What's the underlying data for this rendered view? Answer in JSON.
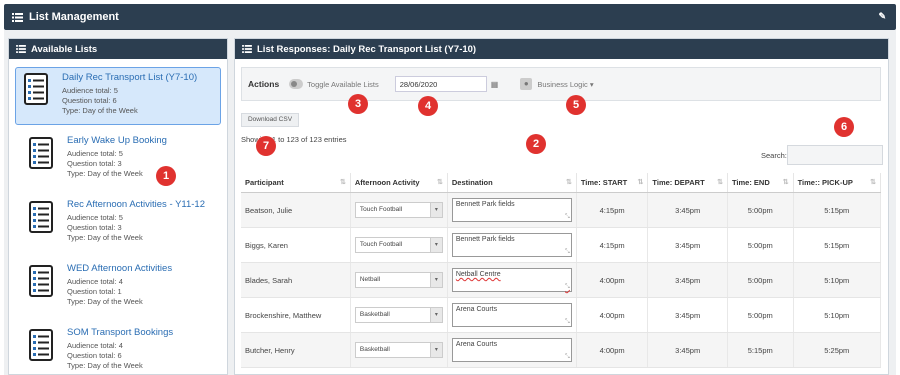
{
  "app": {
    "title": "List Management"
  },
  "left_panel": {
    "title": "Available Lists",
    "items": [
      {
        "title": "Daily Rec Transport List (Y7-10)",
        "audience": "Audience total: 5",
        "questions": "Question total: 6",
        "type": "Type: Day of the Week"
      },
      {
        "title": "Early Wake Up Booking",
        "audience": "Audience total: 5",
        "questions": "Question total: 3",
        "type": "Type: Day of the Week"
      },
      {
        "title": "Rec Afternoon Activities - Y11-12",
        "audience": "Audience total: 5",
        "questions": "Question total: 3",
        "type": "Type: Day of the Week"
      },
      {
        "title": "WED Afternoon Activities",
        "audience": "Audience total: 4",
        "questions": "Question total: 1",
        "type": "Type: Day of the Week"
      },
      {
        "title": "SOM Transport Bookings",
        "audience": "Audience total: 4",
        "questions": "Question total: 6",
        "type": "Type: Day of the Week"
      }
    ]
  },
  "right_panel": {
    "title": "List Responses: Daily Rec Transport List (Y7-10)",
    "actions_label": "Actions",
    "toggle_label": "Toggle Available Lists",
    "date_value": "28/06/2020",
    "business_logic": "Business Logic ▾",
    "download_label": "Download CSV",
    "showing_text": "Showing 1 to 123 of 123 entries",
    "search_label": "Search:",
    "columns": [
      "Participant",
      "Afternoon Activity",
      "Destination",
      "Time: START",
      "Time: DEPART",
      "Time: END",
      "Time:: PICK-UP"
    ],
    "rows": [
      {
        "participant": "Beatson, Julie",
        "activity": "Touch Football",
        "destination": "Bennett Park fields",
        "start": "4:15pm",
        "depart": "3:45pm",
        "end": "5:00pm",
        "pickup": "5:15pm"
      },
      {
        "participant": "Biggs, Karen",
        "activity": "Touch Football",
        "destination": "Bennett Park fields",
        "start": "4:15pm",
        "depart": "3:45pm",
        "end": "5:00pm",
        "pickup": "5:15pm"
      },
      {
        "participant": "Blades, Sarah",
        "activity": "Netball",
        "destination": "Netball Centre",
        "start": "4:00pm",
        "depart": "3:45pm",
        "end": "5:00pm",
        "pickup": "5:10pm"
      },
      {
        "participant": "Brockenshire, Matthew",
        "activity": "Basketball",
        "destination": "Arena Courts",
        "start": "4:00pm",
        "depart": "3:45pm",
        "end": "5:00pm",
        "pickup": "5:10pm"
      },
      {
        "participant": "Butcher, Henry",
        "activity": "Basketball",
        "destination": "Arena Courts",
        "start": "4:00pm",
        "depart": "3:45pm",
        "end": "5:15pm",
        "pickup": "5:25pm"
      }
    ]
  },
  "badges": [
    "1",
    "2",
    "3",
    "4",
    "5",
    "6",
    "7"
  ]
}
